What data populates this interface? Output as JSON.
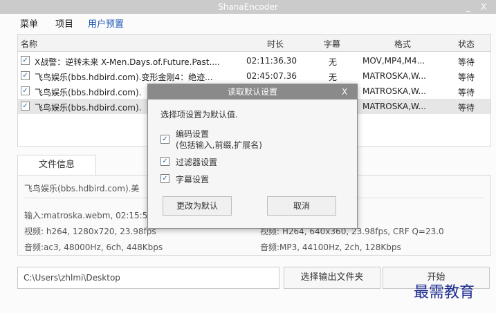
{
  "window": {
    "title": "ShanaEncoder",
    "minimize": "_",
    "close": "X"
  },
  "menu": [
    "菜单",
    "项目",
    "用户预置"
  ],
  "table": {
    "headers": [
      "名称",
      "时长",
      "字幕",
      "格式",
      "状态"
    ],
    "rows": [
      {
        "name": "X战警：逆转未来 X-Men.Days.of.Future.Past....",
        "duration": "02:11:36.30",
        "subtitle": "无",
        "format": "MOV,MP4,M4...",
        "status": "等待"
      },
      {
        "name": "飞鸟娱乐(bbs.hdbird.com).变形金刚4：绝迹...",
        "duration": "02:45:07.36",
        "subtitle": "无",
        "format": "MATROSKA,W...",
        "status": "等待"
      },
      {
        "name": "飞鸟娱乐(bbs.hdbird.com).",
        "duration": "",
        "subtitle": "",
        "format": "MATROSKA,W...",
        "status": "等待"
      },
      {
        "name": "飞鸟娱乐(bbs.hdbird.com).",
        "duration": "",
        "subtitle": "",
        "format": "MATROSKA,W...",
        "status": "等待"
      }
    ]
  },
  "info": {
    "tab": "文件信息",
    "filename": "飞鸟娱乐(bbs.hdbird.com).美",
    "input": "输入:matroska.webm, 02:15:54",
    "video": "视频: h264, 1280x720, 23.98fps",
    "audio": "音频:ac3, 48000Hz, 6ch, 448Kbps",
    "out_video": "视频: H264, 640x360, 23.98fps, CRF Q=23.0",
    "out_audio": "音频:MP3, 44100Hz, 2ch, 128Kbps"
  },
  "bottom": {
    "path": "C:\\Users\\zhlmi\\Desktop",
    "choose_folder": "选择输出文件夹",
    "start": "开始",
    "watermark": "最需教育"
  },
  "dialog": {
    "title": "读取默认设置",
    "close": "X",
    "prompt": "选择项设置为默认值.",
    "options": [
      {
        "label": "编码设置",
        "sub": "(包括输入,前缀,扩展名)"
      },
      {
        "label": "过滤器设置",
        "sub": ""
      },
      {
        "label": "字幕设置",
        "sub": ""
      }
    ],
    "ok": "更改为默认",
    "cancel": "取消"
  },
  "colors": {
    "menu_accent": "#1f57b8",
    "dialog_title": "#8a8a8a",
    "watermark": "#1d2d8f"
  }
}
